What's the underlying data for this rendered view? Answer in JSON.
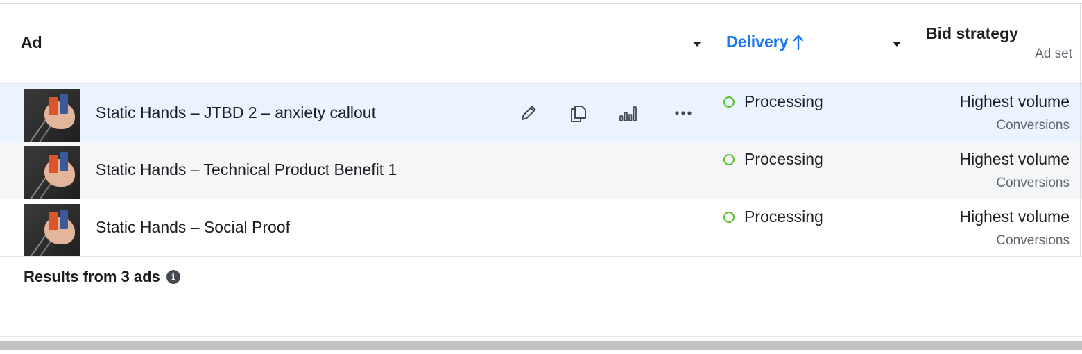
{
  "columns": {
    "ad": "Ad",
    "delivery": "Delivery",
    "delivery_sort_icon": "arrow-up-icon",
    "bid_strategy": "Bid strategy",
    "bid_strategy_sub": "Ad set"
  },
  "rows": [
    {
      "name": "Static Hands – JTBD 2 – anxiety callout",
      "status": "Processing",
      "bid": "Highest volume",
      "bid_sub": "Conversions"
    },
    {
      "name": "Static Hands – Technical Product Benefit 1",
      "status": "Processing",
      "bid": "Highest volume",
      "bid_sub": "Conversions"
    },
    {
      "name": "Static Hands – Social Proof",
      "status": "Processing",
      "bid": "Highest volume",
      "bid_sub": "Conversions"
    }
  ],
  "row_actions": [
    "edit-icon",
    "duplicate-icon",
    "chart-icon",
    "more-icon"
  ],
  "summary": {
    "label": "Results from 3 ads",
    "icon": "info-icon"
  },
  "colors": {
    "accent": "#1877f2",
    "status_dot": "#5ac024",
    "row_hover": "#eaf3ff",
    "row_alt": "#f5f6f7"
  }
}
